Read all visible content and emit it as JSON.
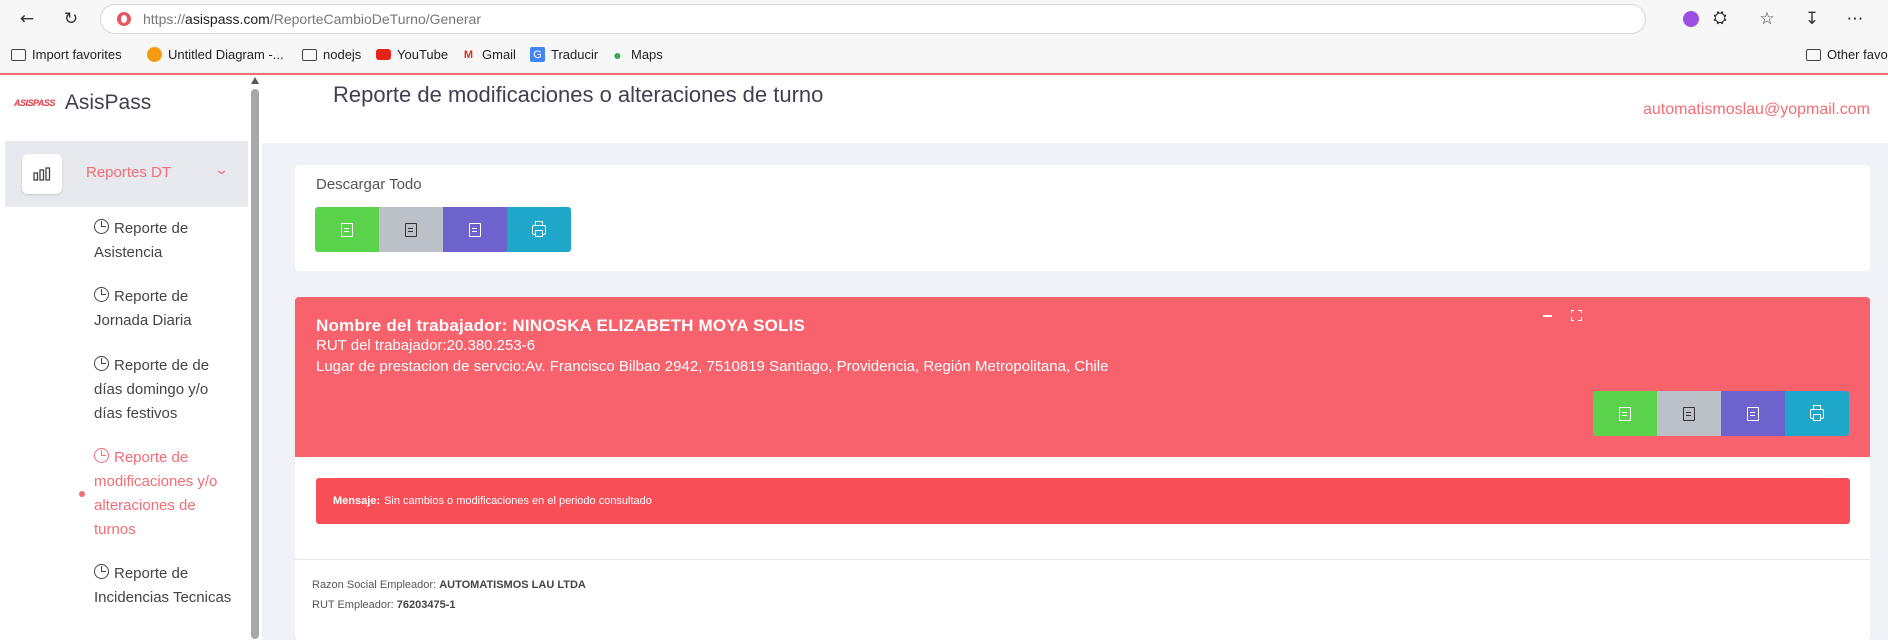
{
  "browser": {
    "url_prefix": "https://",
    "url_host": "asispass.com",
    "url_path": "/ReporteCambioDeTurno/Generar",
    "bookmarks": [
      {
        "label": "Import favorites",
        "icon": "import-icon"
      },
      {
        "label": "Untitled Diagram -...",
        "icon": "drawio-icon"
      },
      {
        "label": "nodejs",
        "icon": "folder-icon"
      },
      {
        "label": "YouTube",
        "icon": "youtube-icon"
      },
      {
        "label": "Gmail",
        "icon": "gmail-icon"
      },
      {
        "label": "Traducir",
        "icon": "translate-icon"
      },
      {
        "label": "Maps",
        "icon": "maps-icon"
      }
    ],
    "other_favorites": "Other favor"
  },
  "sidebar": {
    "logo_text": "ASISPASS",
    "brand": "AsisPass",
    "section": {
      "label": "Reportes DT",
      "icon": "bar-chart-icon"
    },
    "items": [
      {
        "label": "Reporte de Asistencia",
        "active": false
      },
      {
        "label": "Reporte de Jornada Diaria",
        "active": false
      },
      {
        "label": "Reporte de de días domingo y/o días festivos",
        "active": false
      },
      {
        "label": "Reporte de modificaciones y/o alteraciones de turnos",
        "active": true
      },
      {
        "label": "Reporte de Incidencias Tecnicas",
        "active": false
      }
    ]
  },
  "header": {
    "title": "Reporte de modificaciones o alteraciones de turno",
    "user_email": "automatismoslau@yopmail.com"
  },
  "download": {
    "title": "Descargar Todo",
    "buttons": [
      {
        "name": "excel",
        "icon": "excel-icon",
        "color": "#5bd24b"
      },
      {
        "name": "pdf",
        "icon": "pdf-icon",
        "color": "#bcc0c7"
      },
      {
        "name": "word",
        "icon": "word-icon",
        "color": "#6e63cc"
      },
      {
        "name": "print",
        "icon": "print-icon",
        "color": "#1fa7c9"
      }
    ]
  },
  "worker": {
    "name_line": "Nombre del trabajador: NINOSKA ELIZABETH MOYA SOLIS",
    "rut_line": "RUT del trabajador:20.380.253-6",
    "place_line": "Lugar de prestacion de servcio:Av. Francisco Bilbao 2942, 7510819 Santiago, Providencia, Región Metropolitana, Chile",
    "message_label": "Mensaje:",
    "message_text": "Sin cambios o modificaciones en el periodo consultado",
    "employer_label": "Razon Social Empleador:",
    "employer_value": "AUTOMATISMOS LAU LTDA",
    "employer_rut_label": "RUT Empleador:",
    "employer_rut_value": "76203475-1"
  },
  "colors": {
    "accent": "#f36d75",
    "worker_header": "#f7626c",
    "message": "#f74e58"
  }
}
